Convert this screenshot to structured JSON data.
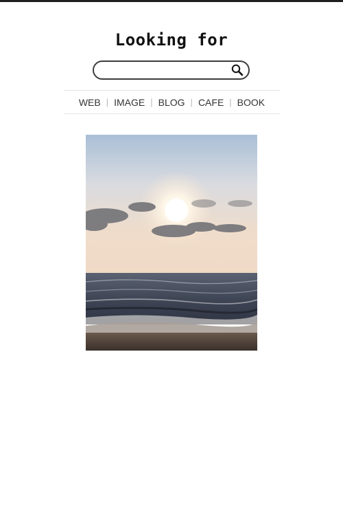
{
  "header": {
    "title": "Looking for"
  },
  "search": {
    "value": "",
    "placeholder": "",
    "button_icon": "search-icon"
  },
  "nav": {
    "items": [
      {
        "label": "WEB"
      },
      {
        "label": "IMAGE"
      },
      {
        "label": "BLOG"
      },
      {
        "label": "CAFE"
      },
      {
        "label": "BOOK"
      }
    ],
    "separator": "|"
  },
  "result": {
    "image_subject": "sunset-over-beach-photo"
  },
  "colors": {
    "top_bar": "#1f1f1f",
    "search_border": "#3c3c3c",
    "nav_border": "#e6e6e6",
    "separator": "#b8b8b8"
  }
}
